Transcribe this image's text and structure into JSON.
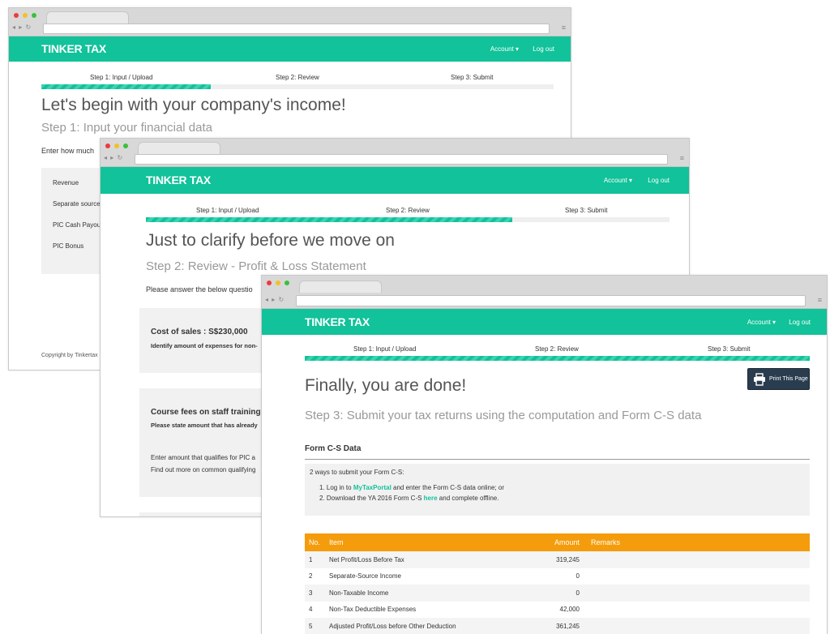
{
  "brand": {
    "name": "TINKER TAX",
    "accent": "#11c29a",
    "table_header": "#f49c0b"
  },
  "nav": {
    "account": "Account",
    "logout": "Log out"
  },
  "steps": [
    "Step 1: Input / Upload",
    "Step 2: Review",
    "Step 3: Submit"
  ],
  "window1": {
    "progress": 0.33,
    "title": "Let's begin with your company's income!",
    "subtitle": "Step 1: Input your financial data",
    "intro": "Enter how much",
    "rows": [
      "Revenue",
      "Separate source",
      "PIC Cash Payout",
      "PIC Bonus"
    ],
    "copyright": "Copyright by Tinkertax"
  },
  "window2": {
    "progress": 0.7,
    "title": "Just to clarify before we move on",
    "subtitle": "Step 2: Review - Profit & Loss Statement",
    "intro": "Please answer the below questio",
    "card1": {
      "heading": "Cost of sales : S$230,000",
      "note": "Identify amount of expenses for non-"
    },
    "card2": {
      "heading": "Course fees on staff training : S",
      "note": "Please state amount that has already",
      "line1": "Enter amount that qualifies for PIC a",
      "line2": "Find out more on common qualifying"
    }
  },
  "window3": {
    "progress": 1.0,
    "title": "Finally, you are done!",
    "subtitle": "Step 3: Submit your tax returns using the computation and Form C-S data",
    "print_label": "Print This Page",
    "section_title": "Form C-S Data",
    "box_intro": "2 ways to submit your Form C-S:",
    "item1": {
      "num": "1.",
      "pre": "Log in to ",
      "link": "MyTaxPortal",
      "post": " and enter the Form C-S data online; or"
    },
    "item2": {
      "num": "2.",
      "pre": "Download the YA 2016 Form C-S ",
      "link": "here",
      "post": " and complete offline."
    },
    "columns": {
      "no": "No.",
      "item": "Item",
      "amount": "Amount",
      "remarks": "Remarks"
    },
    "rows": [
      {
        "no": "1",
        "item": "Net Profit/Loss Before Tax",
        "amount": "319,245"
      },
      {
        "no": "2",
        "item": "Separate-Source Income",
        "amount": "0"
      },
      {
        "no": "3",
        "item": "Non-Taxable Income",
        "amount": "0"
      },
      {
        "no": "4",
        "item": "Non-Tax Deductible Expenses",
        "amount": "42,000"
      },
      {
        "no": "5",
        "item": "Adjusted Profit/Loss before Other Deduction",
        "amount": "361,245"
      }
    ]
  }
}
